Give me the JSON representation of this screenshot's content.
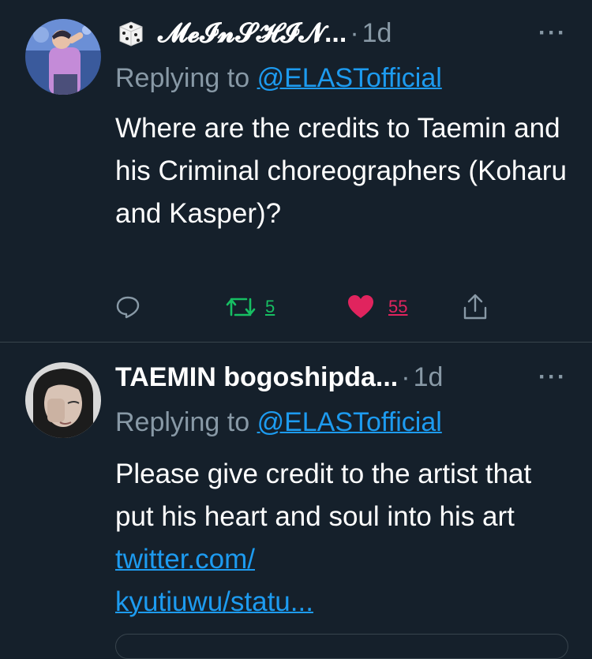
{
  "tweets": [
    {
      "display_name": "𝓜𝓮𝓘𝓷𝓢𝓗𝓘𝓝...",
      "time": "1d",
      "replying_prefix": "Replying to",
      "replying_to": "@ELASTofficial",
      "text": "Where are the credits to Taemin and his Criminal choreographers (Koharu and Kasper)?",
      "retweets": "5",
      "likes": "55",
      "liked": true
    },
    {
      "display_name": "TAEMIN bogoshipda...",
      "time": "1d",
      "replying_prefix": "Replying to",
      "replying_to": "@ELASTofficial",
      "text": "Please give credit to the artist that put his heart and soul into his art",
      "link_line1": "twitter.com/",
      "link_line2": "kyutiuwu/statu..."
    }
  ],
  "separator": "·",
  "more_glyph": "···",
  "colors": {
    "background": "#15202b",
    "text": "#ffffff",
    "muted": "#8899a6",
    "link": "#1d9bf0",
    "retweet": "#17bf63",
    "like": "#e0245e"
  }
}
